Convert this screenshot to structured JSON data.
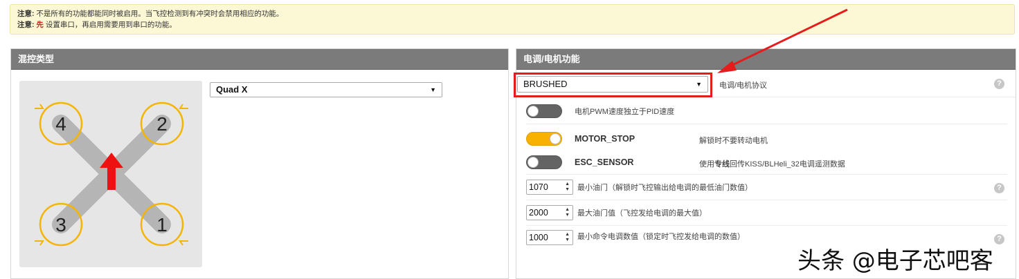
{
  "notice": {
    "line1_label": "注意:",
    "line1_text": " 不是所有的功能都能同时被启用。当飞控检测到有冲突时会禁用相应的功能。",
    "line2_label": "注意:",
    "line2_highlight": " 先",
    "line2_text": " 设置串口，再启用需要用到串口的功能。"
  },
  "mixer": {
    "title": "混控类型",
    "frame_type": "Quad X",
    "motors": [
      "4",
      "2",
      "3",
      "1"
    ]
  },
  "esc": {
    "title": "电调/电机功能",
    "protocol_value": "BRUSHED",
    "protocol_label": "电调/电机协议",
    "help_glyph": "?",
    "pwm_label": "电机PWM速度独立于PID速度",
    "motor_stop": {
      "name": "MOTOR_STOP",
      "desc": "解锁时不要转动电机",
      "enabled": true
    },
    "esc_sensor": {
      "name": "ESC_SENSOR",
      "desc_pre": "使用",
      "desc_bold": "专线",
      "desc_post": "回传KISS/BLHeli_32电调遥测数据",
      "enabled": false
    },
    "min_throttle": {
      "value": "1070",
      "label": "最小油门（解锁时飞控输出给电调的最低油门数值）"
    },
    "max_throttle": {
      "value": "2000",
      "label": "最大油门值（飞控发给电调的最大值）"
    },
    "min_command": {
      "value": "1000",
      "label": "最小命令电调数值（锁定时飞控发给电调的数值）"
    }
  },
  "watermark": "头条 @电子芯吧客",
  "colors": {
    "accent": "#f8b100",
    "highlight": "#e41c1c",
    "header": "#7b7b7b"
  }
}
